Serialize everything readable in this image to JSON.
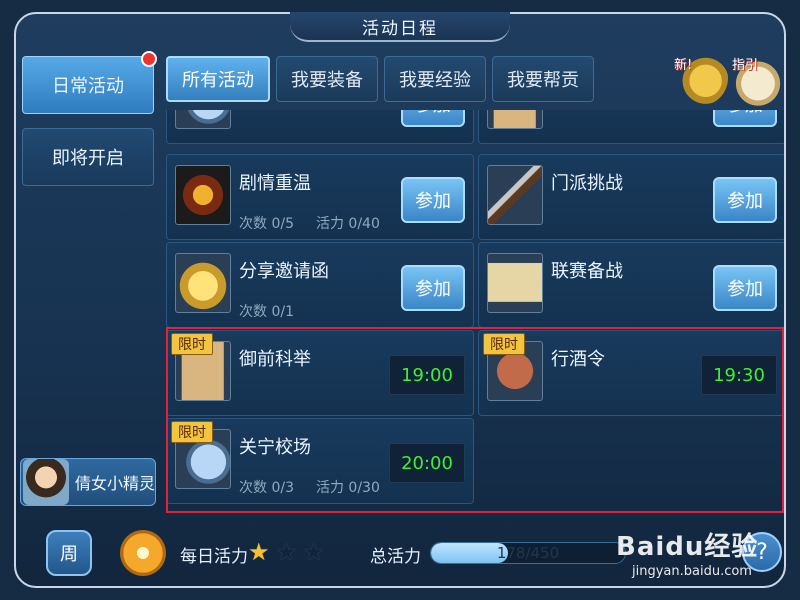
{
  "title": "活动日程",
  "sidebar": {
    "items": [
      {
        "label": "日常活动",
        "active": true,
        "has_notification": true
      },
      {
        "label": "即将开启",
        "active": false
      }
    ],
    "sprite": {
      "label": "倩女小精灵"
    }
  },
  "tabs": [
    {
      "label": "所有活动",
      "active": true
    },
    {
      "label": "我要装备",
      "active": false
    },
    {
      "label": "我要经验",
      "active": false
    },
    {
      "label": "我要帮贡",
      "active": false
    }
  ],
  "corner_icons": {
    "new_label": "新!",
    "guide_label": "指引"
  },
  "activities": {
    "row0": [
      {
        "join_label": "参加"
      },
      {
        "join_label": "参加"
      }
    ],
    "row1": [
      {
        "name": "剧情重温",
        "count": "次数 0/5",
        "vitality": "活力 0/40",
        "join_label": "参加",
        "icon": "crown-icon"
      },
      {
        "name": "门派挑战",
        "join_label": "参加",
        "icon": "sword-icon"
      }
    ],
    "row2": [
      {
        "name": "分享邀请函",
        "count": "次数 0/1",
        "join_label": "参加",
        "icon": "gold-ingot-icon"
      },
      {
        "name": "联赛备战",
        "join_label": "参加",
        "icon": "scroll-icon"
      }
    ],
    "row3": [
      {
        "limited_label": "限时",
        "name": "御前科举",
        "time": "19:00",
        "icon": "book-icon"
      },
      {
        "limited_label": "限时",
        "name": "行酒令",
        "time": "19:30",
        "icon": "seal-icon"
      }
    ],
    "row4": [
      {
        "limited_label": "限时",
        "name": "关宁校场",
        "count": "次数 0/3",
        "vitality": "活力 0/30",
        "time": "20:00",
        "icon": "cloth-bag-icon"
      }
    ]
  },
  "bottom": {
    "week_label": "周",
    "daily_label": "每日活力",
    "stars_filled": 0.5,
    "stars_total": 3,
    "total_label": "总活力",
    "total_value": "178/450",
    "total_progress": 0.396,
    "help_label": "?"
  },
  "watermark": {
    "brand": "Baidu经验",
    "url": "jingyan.baidu.com"
  },
  "colors": {
    "highlight_border": "#e0223a",
    "time_green": "#3ff02f",
    "accent_blue": "#5eb2ee"
  }
}
